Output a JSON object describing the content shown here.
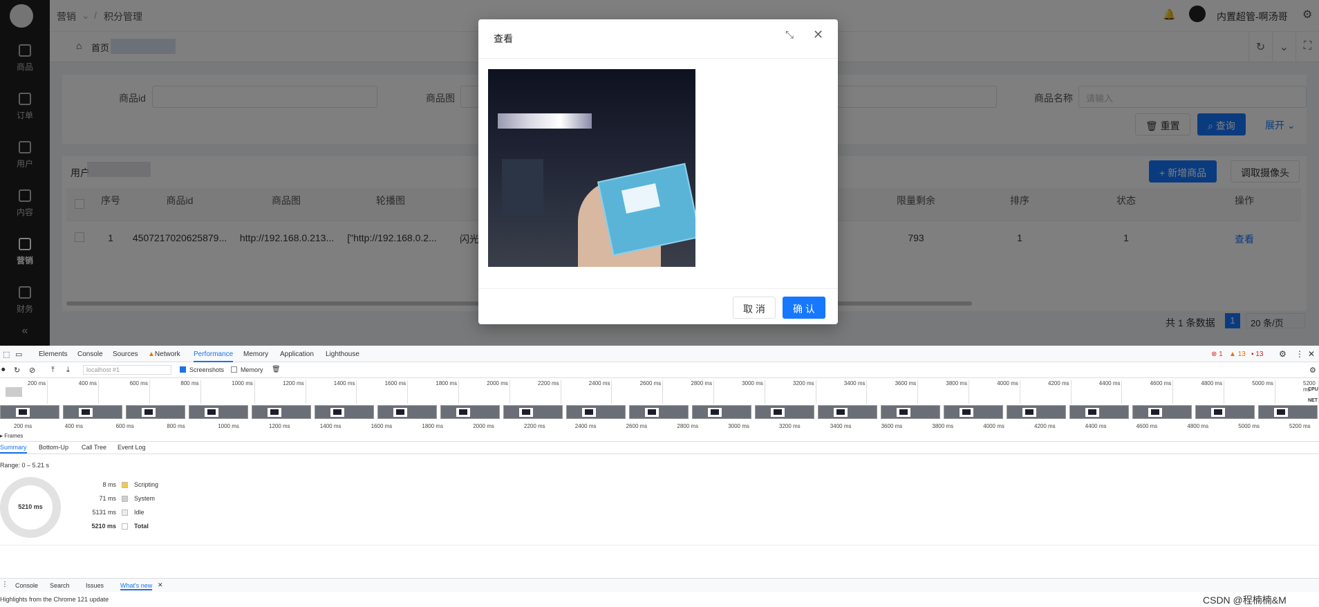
{
  "sidebar": {
    "items": [
      {
        "label": "商品"
      },
      {
        "label": "订单"
      },
      {
        "label": "用户"
      },
      {
        "label": "内容"
      },
      {
        "label": "营销"
      },
      {
        "label": "财务"
      }
    ],
    "collapse": "«"
  },
  "topbar": {
    "breadcrumb_1": "营销",
    "breadcrumb_sep": "/",
    "breadcrumb_2": "积分管理",
    "user": "内置超管-啊汤哥"
  },
  "tabs": {
    "home": "首页"
  },
  "filter": {
    "id_label": "商品id",
    "image_label": "商品图",
    "name_label": "商品名称",
    "name_placeholder": "请输入",
    "reset": "重置",
    "search": "查询",
    "expand": "展开"
  },
  "table": {
    "title": "用户",
    "add_button": "新增商品",
    "camera_button": "调取摄像头",
    "headers": [
      "序号",
      "商品id",
      "商品图",
      "轮播图",
      "",
      "限量剩余",
      "排序",
      "状态",
      "操作"
    ],
    "row": {
      "index": "1",
      "id": "4507217020625879...",
      "image": "http://192.168.0.213...",
      "carousel": "[\"http://192.168.0.2...",
      "name": "闪光",
      "remaining": "793",
      "sort": "1",
      "status": "1",
      "action": "查看"
    },
    "total": "共 1 条数据",
    "page": "1",
    "page_size": "20 条/页"
  },
  "modal": {
    "title": "查看",
    "cancel": "取 消",
    "confirm": "确 认"
  },
  "devtools": {
    "tabs": [
      "Elements",
      "Console",
      "Sources",
      "Network",
      "Performance",
      "Memory",
      "Application",
      "Lighthouse"
    ],
    "errors": "1",
    "warnings": "13",
    "issues": "13",
    "url": "localhost #1",
    "screenshots": "Screenshots",
    "memory": "Memory",
    "ticks": [
      "200 ms",
      "400 ms",
      "600 ms",
      "800 ms",
      "1000 ms",
      "1200 ms",
      "1400 ms",
      "1600 ms",
      "1800 ms",
      "2000 ms",
      "2200 ms",
      "2400 ms",
      "2600 ms",
      "2800 ms",
      "3000 ms",
      "3200 ms",
      "3400 ms",
      "3600 ms",
      "3800 ms",
      "4000 ms",
      "4200 ms",
      "4400 ms",
      "4600 ms",
      "4800 ms",
      "5000 ms",
      "5200 ms"
    ],
    "cpu": "CPU",
    "net": "NET",
    "frames": "Frames",
    "subtabs": [
      "Summary",
      "Bottom-Up",
      "Call Tree",
      "Event Log"
    ],
    "range": "Range: 0 – 5.21 s",
    "donut": "5210 ms",
    "summary": [
      {
        "value": "8 ms",
        "label": "Scripting",
        "color": "#f2c94c"
      },
      {
        "value": "71 ms",
        "label": "System",
        "color": "#cfcfcf"
      },
      {
        "value": "5131 ms",
        "label": "Idle",
        "color": "#ececec"
      },
      {
        "value": "5210 ms",
        "label": "Total",
        "color": "#ffffff"
      }
    ],
    "drawer_tabs": [
      "Console",
      "Search",
      "Issues",
      "What's new"
    ],
    "footer": "Highlights from the Chrome 121 update"
  },
  "watermark": "CSDN @程楠楠&M"
}
